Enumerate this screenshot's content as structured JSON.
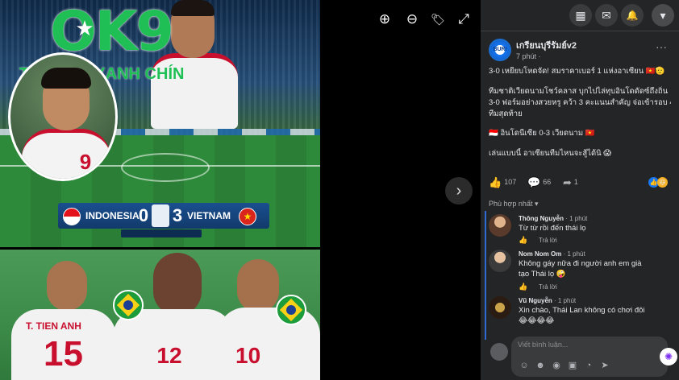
{
  "photo": {
    "brand_text": "OK9",
    "brand_star": "★",
    "tagline": "TỶ THAO XANH CHÍN",
    "inset_number": "9",
    "scoreboard": {
      "team1": "INDONESIA",
      "score1": "0",
      "score2": "3",
      "team2": "VIETNAM"
    },
    "bottom": {
      "player_name": "T. TIEN ANH",
      "numbers": [
        "15",
        "12",
        "10"
      ]
    }
  },
  "viewer": {
    "zoom_in_icon": "⊕",
    "zoom_out_icon": "⊖",
    "tag_icon": "🏷",
    "fullscreen_icon": "⤢",
    "next_icon": "›"
  },
  "topbar": {
    "menu_icon": "▦",
    "messenger_icon": "✉",
    "bell_icon": "🔔",
    "account_icon": "▾"
  },
  "post": {
    "page_name": "เกรียนบุรีรัมย์v2",
    "time": "7 phút ·",
    "more": "···",
    "avatar_text": "BURI",
    "lines": [
      "3-0 เหยียบโหดจัด! สมราคาเบอร์ 1 แห่งอาเซียน 🇻🇳🫡",
      "ทีมชาติเวียดนามโชว์คลาส บุกไปไล่ทุบอินโดดัดซ์ถึงถิ่น",
      "3-0 ฟอร์มอย่างสวยหรู คว้า 3 คะแนนสำคัญ จ่อเข้ารอบ 4",
      "ทีมสุดท้าย",
      "🇮🇩 อินโดนีเซีย 0-3 เวียดนาม 🇻🇳",
      "เล่นแบบนี้ อาเซียนทีมไหนจะสู้ได้นิ 😱"
    ],
    "stats": {
      "likes": "107",
      "comments": "66",
      "shares": "1"
    }
  },
  "comments": {
    "sort_label": "Phù hợp nhất ▾",
    "items": [
      {
        "name": "Thông Nguyễn",
        "time": "· 1 phút",
        "lines": [
          "Từ từ rồi đến thái lọ"
        ],
        "reply": "Trả lời"
      },
      {
        "name": "Nom Nom Om",
        "time": "· 1 phút",
        "lines": [
          "Không gáy nữa đi người anh em già",
          "tạo Thái lọ 🤪"
        ],
        "reply": "Trả lời"
      },
      {
        "name": "Vũ Nguyễn",
        "time": "· 1 phút",
        "lines": [
          "Xin chào, Thái Lan không có chơi đôi",
          "😂😂😂😂"
        ],
        "reply": ""
      }
    ],
    "composer_placeholder": "Viết bình luận..."
  },
  "colors": {
    "brand_green": "#1fbf55",
    "vietnam_red": "#c8102e",
    "panel_bg": "#242526",
    "accent_blue": "#2d6ad4"
  }
}
